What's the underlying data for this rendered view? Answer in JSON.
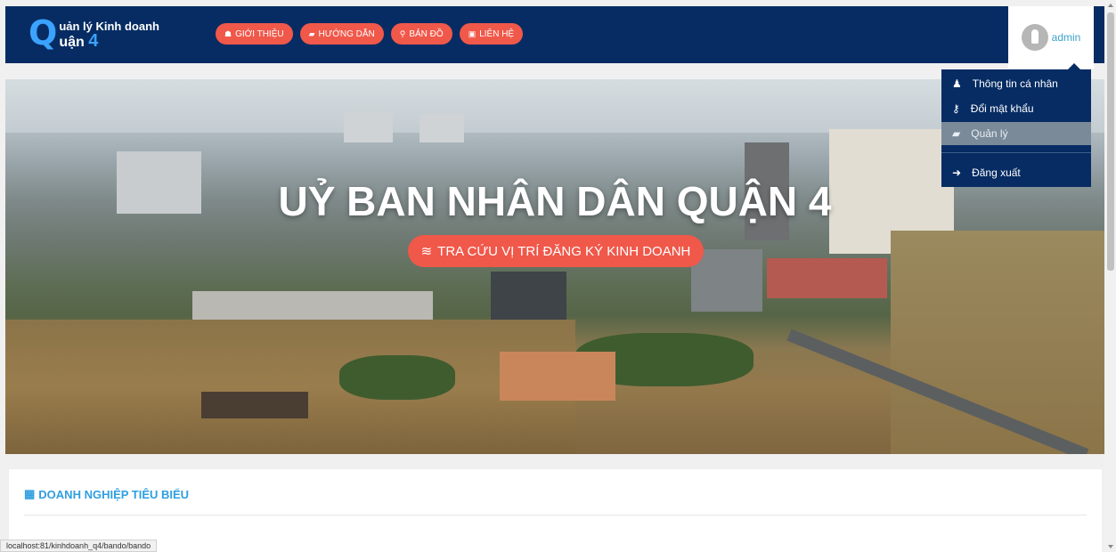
{
  "logo": {
    "letter": "Q",
    "line1": "uản lý Kinh doanh",
    "line2_text": "uận",
    "line2_num": "4"
  },
  "nav": [
    {
      "icon": "home-icon",
      "glyph": "☗",
      "label": "GIỚI THIỆU"
    },
    {
      "icon": "book-icon",
      "glyph": "▰",
      "label": "HƯỚNG DẪN"
    },
    {
      "icon": "map-marker-icon",
      "glyph": "⚲",
      "label": "BẢN ĐỒ"
    },
    {
      "icon": "contact-card-icon",
      "glyph": "▣",
      "label": "LIÊN HỆ"
    }
  ],
  "user": {
    "name": "admin"
  },
  "dropdown": {
    "items": [
      {
        "icon": "user-icon",
        "glyph": "♟",
        "label": "Thông tin cá nhân",
        "active": false
      },
      {
        "icon": "key-icon",
        "glyph": "⚷",
        "label": "Đổi mật khẩu",
        "active": false
      },
      {
        "icon": "book-icon",
        "glyph": "▰",
        "label": "Quản lý",
        "active": true
      },
      {
        "icon": "logout-icon",
        "glyph": "➜",
        "label": "Đăng xuất",
        "active": false
      }
    ]
  },
  "hero": {
    "title": "UỶ BAN NHÂN DÂN QUẬN 4",
    "button_label": "TRA CỨU VỊ TRÍ ĐĂNG KÝ KINH DOANH",
    "button_icon": "layers-icon",
    "button_glyph": "≋"
  },
  "section": {
    "icon": "building-icon",
    "glyph": "▦",
    "title": "DOANH NGHIỆP TIÊU BIỂU"
  },
  "status_url": "localhost:81/kinhdoanh_q4/bando/bando",
  "colors": {
    "navbar": "#062c63",
    "accent": "#f0584a",
    "logo_blue": "#3ba2ff",
    "section_title": "#2f9fe0"
  }
}
